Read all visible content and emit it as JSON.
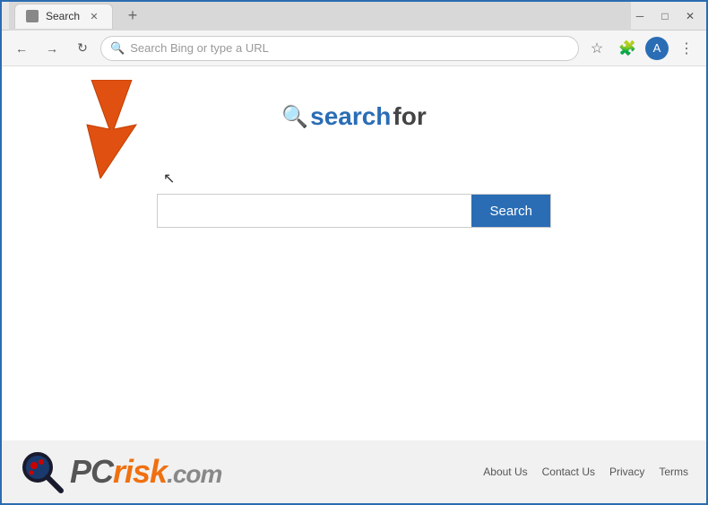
{
  "window": {
    "title": "Search",
    "border_color": "#2b6cb0"
  },
  "titlebar": {
    "tab_label": "Search",
    "new_tab_label": "+",
    "close_label": "✕",
    "minimize_label": "─",
    "maximize_label": "□"
  },
  "navbar": {
    "back_label": "←",
    "forward_label": "→",
    "refresh_label": "↻",
    "address_placeholder": "Search Bing or type a URL",
    "more_label": "⋮"
  },
  "logo": {
    "text_search": "search",
    "text_for": "for"
  },
  "search": {
    "input_placeholder": "",
    "button_label": "Search"
  },
  "footer": {
    "pcrisk_text": "PC",
    "pcrisk_suffix": "risk.com",
    "links": [
      {
        "label": "About Us",
        "id": "about-us"
      },
      {
        "label": "Contact Us",
        "id": "contact-us"
      },
      {
        "label": "Privacy",
        "id": "privacy"
      },
      {
        "label": "Terms",
        "id": "terms"
      }
    ]
  }
}
